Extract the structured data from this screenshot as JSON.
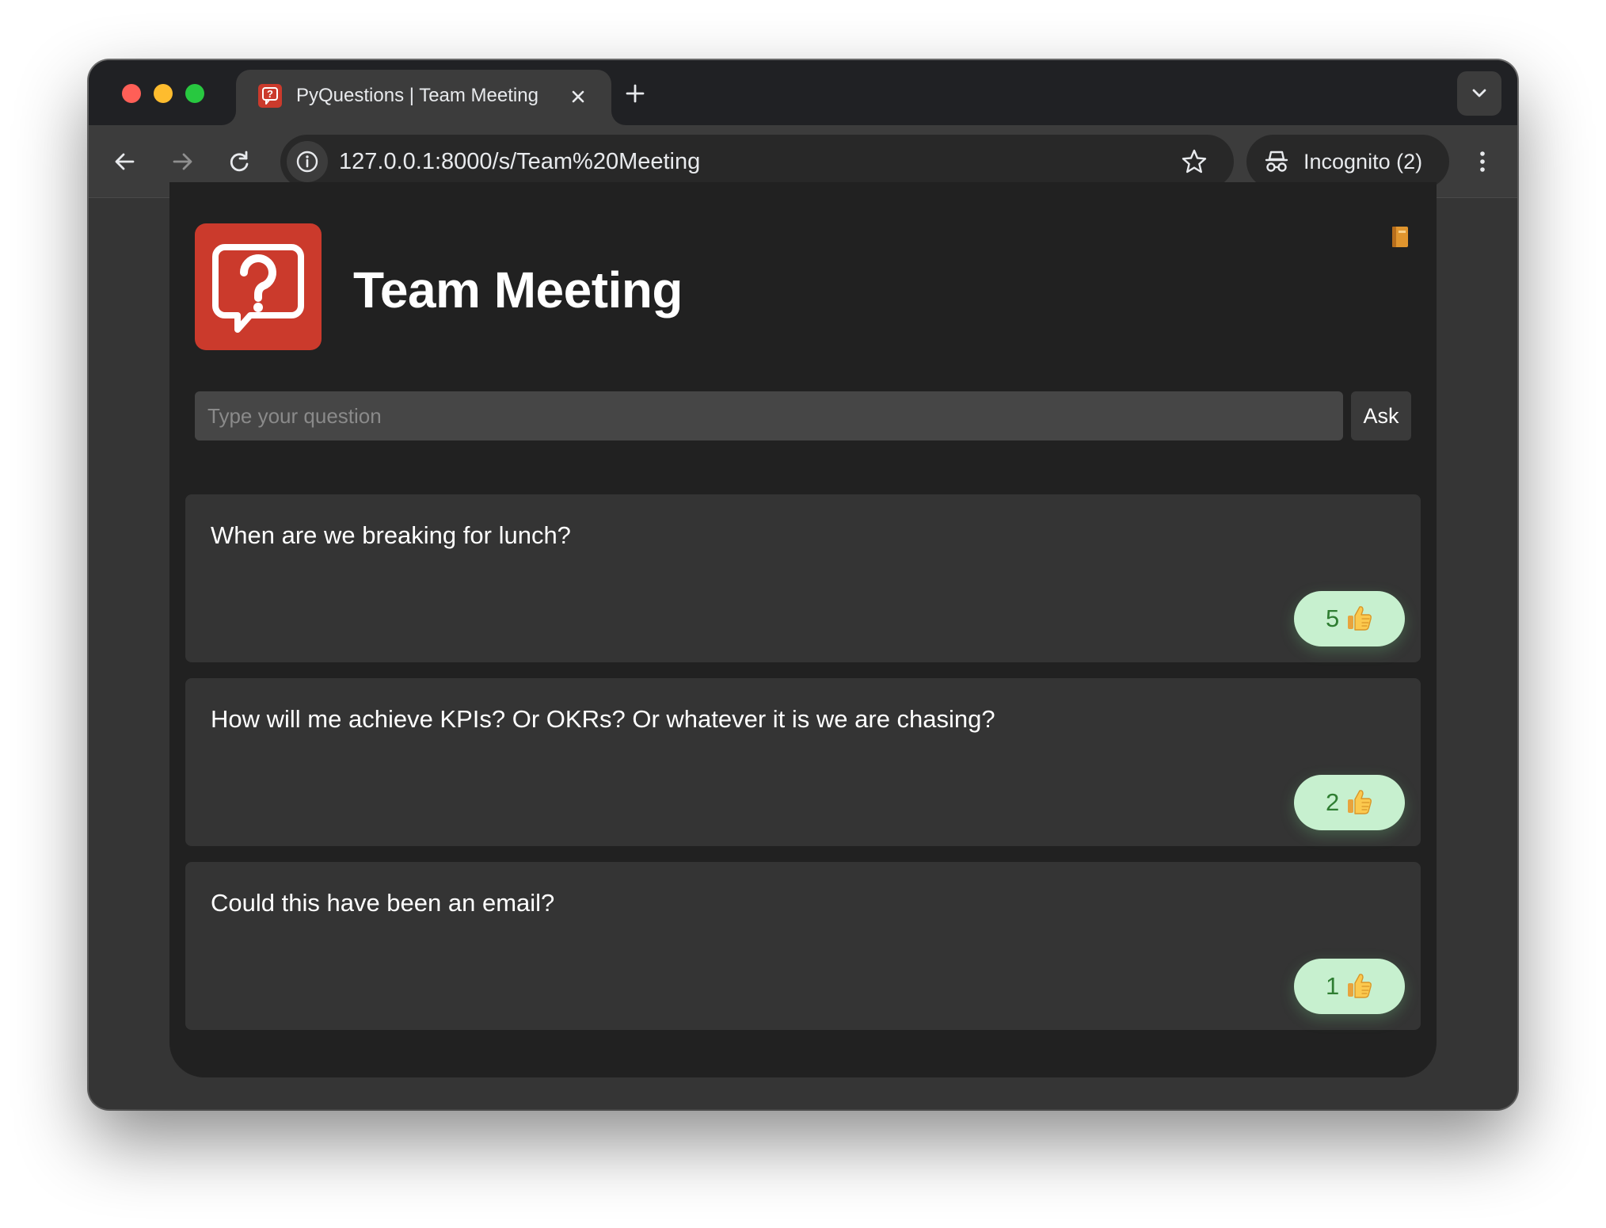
{
  "browser": {
    "tab_title": "PyQuestions | Team Meeting",
    "url": "127.0.0.1:8000/s/Team%20Meeting",
    "incognito_label": "Incognito (2)"
  },
  "page": {
    "title": "Team Meeting",
    "input_placeholder": "Type your question",
    "ask_label": "Ask"
  },
  "questions": [
    {
      "text": "When are we breaking for lunch?",
      "votes": "5"
    },
    {
      "text": "How will me achieve KPIs? Or OKRs? Or whatever it is we are chasing?",
      "votes": "2"
    },
    {
      "text": "Could this have been an email?",
      "votes": "1"
    }
  ],
  "colors": {
    "brand_red": "#cb3a2c",
    "vote_bg": "#c7f0cf",
    "vote_text": "#2f7d32"
  },
  "icons": [
    "question-bubble-icon",
    "close-icon",
    "plus-icon",
    "chevron-down-icon",
    "back-arrow-icon",
    "forward-arrow-icon",
    "reload-icon",
    "info-icon",
    "star-icon",
    "incognito-icon",
    "more-vert-icon",
    "notebook-icon",
    "thumbs-up-icon"
  ]
}
